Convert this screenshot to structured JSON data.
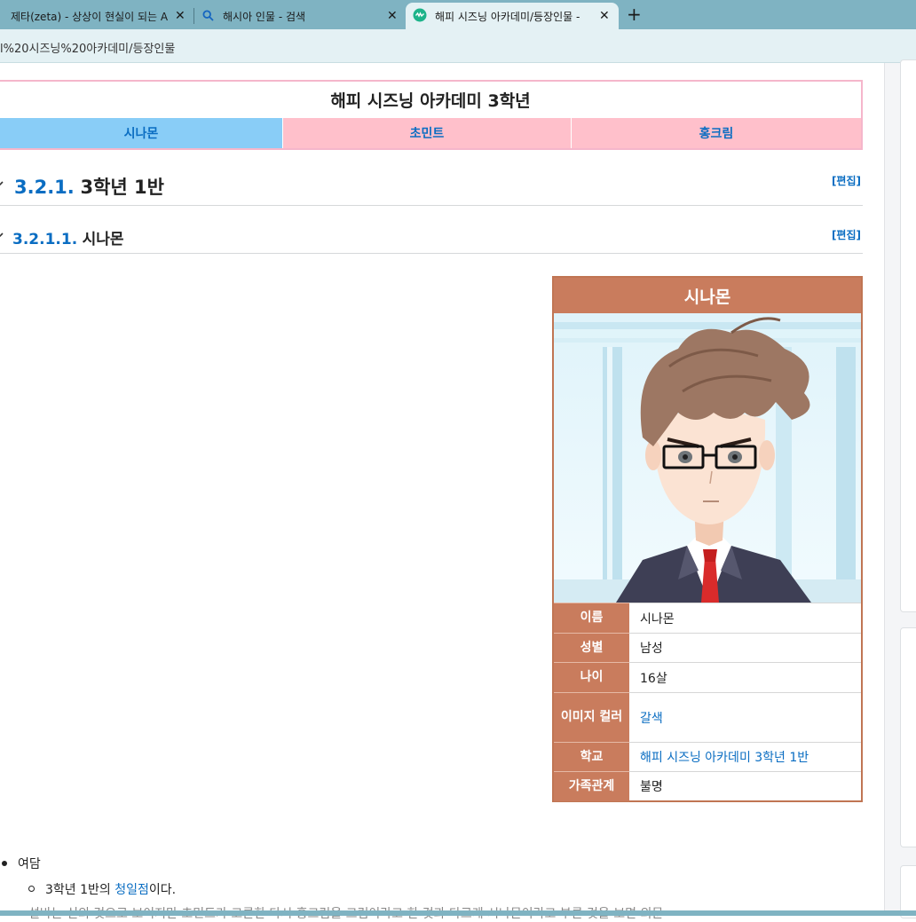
{
  "browser": {
    "tabs": [
      {
        "title": "제타(zeta) - 상상이 현실이 되는 AI",
        "icon": "page-icon"
      },
      {
        "title": "해시아 인물 - 검색",
        "icon": "search-icon"
      },
      {
        "title": "해피 시즈닝 아카데미/등장인물 -",
        "icon": "wiki-icon"
      }
    ],
    "new_tab": "+",
    "close_glyph": "✕",
    "address": "l%20시즈닝%20아카데미/등장인물",
    "colors": {
      "tabbar": "#7fb3c2",
      "active_tab": "#e4f1f4"
    }
  },
  "navbox": {
    "title": "해피 시즈닝 아카데미 3학년",
    "items": [
      "시나몬",
      "초민트",
      "홍크림"
    ]
  },
  "sections": {
    "h3": {
      "number": "3.2.1.",
      "text": "3학년 1반",
      "edit": "[편집]"
    },
    "h4": {
      "number": "3.2.1.1.",
      "text": "시나몬",
      "edit": "[편집]"
    }
  },
  "infobox": {
    "title": "시나몬",
    "accent": "#c97c5d",
    "rows": [
      {
        "key": "이름",
        "value": "시나몬"
      },
      {
        "key": "성별",
        "value": "남성"
      },
      {
        "key": "나이",
        "value": "16살"
      },
      {
        "key": "이미지 컬러",
        "value": "갈색"
      },
      {
        "key": "학교",
        "value": "해피 시즈닝 아카데미 3학년 1반"
      },
      {
        "key": "가족관계",
        "value": "불명"
      }
    ]
  },
  "body": {
    "bullet1": "여담",
    "bullet2_prefix": "3학년 1반의 ",
    "bullet2_link": "청일점",
    "bullet2_suffix": "이다.",
    "bullet3_partial": "설바는 신의 것으로 보이지만 초민트가 고른한 다시 홍크림을 크림이라고 한 것과 다르게 시나몬이라고 부른 것을 보면 의문"
  }
}
